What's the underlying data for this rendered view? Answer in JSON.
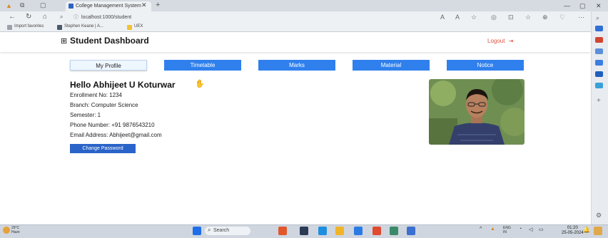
{
  "browser": {
    "tab_title": "College Management System",
    "url": "localhost:1000/student",
    "favorites": [
      "Import favorites",
      "Stephen Keane | A...",
      "UEX"
    ],
    "colors": {
      "chrome": "#d6dbe1",
      "address": "#eef1f4"
    }
  },
  "header": {
    "brand_icon": "grid-icon",
    "title": "Student Dashboard",
    "logout_label": "Logout",
    "logout_color": "#e0523f"
  },
  "tabs": [
    {
      "label": "My Profile",
      "active": true
    },
    {
      "label": "Timetable",
      "active": false
    },
    {
      "label": "Marks",
      "active": false
    },
    {
      "label": "Material",
      "active": false
    },
    {
      "label": "Notice",
      "active": false
    }
  ],
  "profile": {
    "greeting": "Hello Abhijeet U Koturwar",
    "enrollment": "Enrollment No: 1234",
    "branch": "Branch: Computer Science",
    "semester": "Semester: 1",
    "phone": "Phone Number: +91 9876543210",
    "email": "Email Address: Abhijeet@gmail.com",
    "change_password_label": "Change Password"
  },
  "taskbar": {
    "weather_temp": "29°C",
    "weather_desc": "Haze",
    "search_placeholder": "Search",
    "time": "01:20",
    "date": "25-05-2024",
    "lang": "ENG IN"
  },
  "theme": {
    "accent": "#2f80ed",
    "button": "#2a64c8"
  }
}
